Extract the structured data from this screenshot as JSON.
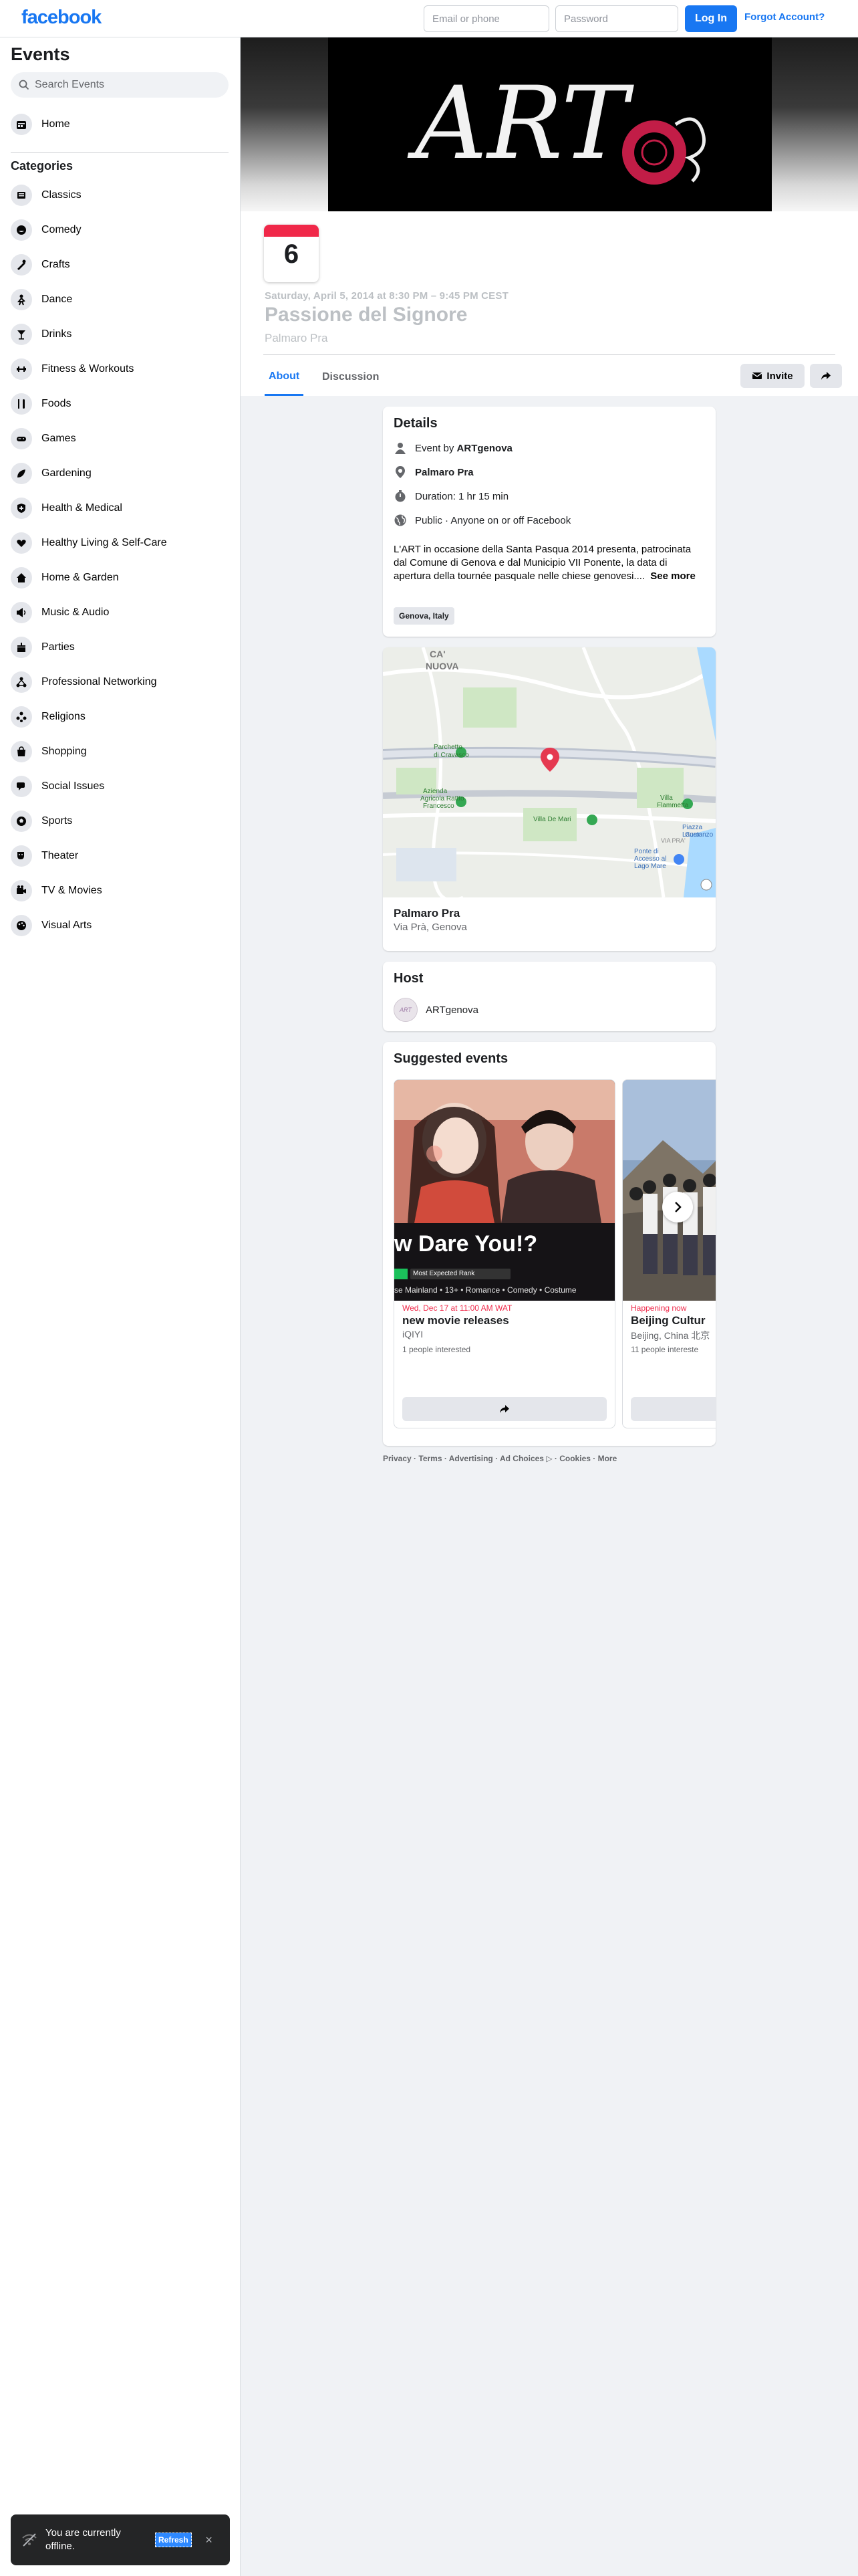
{
  "topbar": {
    "logo": "facebook",
    "email_placeholder": "Email or phone",
    "password_placeholder": "Password",
    "login_label": "Log In",
    "forgot_label": "Forgot Account?"
  },
  "sidebar": {
    "title": "Events",
    "search_placeholder": "Search Events",
    "home_label": "Home",
    "categories_title": "Categories",
    "categories": [
      {
        "label": "Classics",
        "icon": "classics-icon"
      },
      {
        "label": "Comedy",
        "icon": "comedy-icon"
      },
      {
        "label": "Crafts",
        "icon": "crafts-icon"
      },
      {
        "label": "Dance",
        "icon": "dance-icon"
      },
      {
        "label": "Drinks",
        "icon": "drinks-icon"
      },
      {
        "label": "Fitness & Workouts",
        "icon": "fitness-icon"
      },
      {
        "label": "Foods",
        "icon": "foods-icon"
      },
      {
        "label": "Games",
        "icon": "games-icon"
      },
      {
        "label": "Gardening",
        "icon": "gardening-icon"
      },
      {
        "label": "Health & Medical",
        "icon": "health-icon"
      },
      {
        "label": "Healthy Living & Self-Care",
        "icon": "healthy-living-icon"
      },
      {
        "label": "Home & Garden",
        "icon": "home-garden-icon"
      },
      {
        "label": "Music & Audio",
        "icon": "music-icon"
      },
      {
        "label": "Parties",
        "icon": "parties-icon"
      },
      {
        "label": "Professional Networking",
        "icon": "networking-icon"
      },
      {
        "label": "Religions",
        "icon": "religions-icon"
      },
      {
        "label": "Shopping",
        "icon": "shopping-icon"
      },
      {
        "label": "Social Issues",
        "icon": "social-issues-icon"
      },
      {
        "label": "Sports",
        "icon": "sports-icon"
      },
      {
        "label": "Theater",
        "icon": "theater-icon"
      },
      {
        "label": "TV & Movies",
        "icon": "tv-movies-icon"
      },
      {
        "label": "Visual Arts",
        "icon": "visual-arts-icon"
      }
    ]
  },
  "event": {
    "cover_text": "ART",
    "day": "6",
    "date_line": "Saturday, April 5, 2014 at 8:30 PM – 9:45 PM CEST",
    "title": "Passione del Signore",
    "location": "Palmaro Pra",
    "tabs": [
      "About",
      "Discussion"
    ],
    "invite_label": "Invite"
  },
  "details": {
    "title": "Details",
    "event_by_prefix": "Event by ",
    "event_by": "ARTgenova",
    "place": "Palmaro Pra",
    "duration": "Duration: 1 hr 15 min",
    "privacy": "Public · Anyone on or off Facebook",
    "description": "L'ART in occasione della Santa Pasqua 2014 presenta, patrocinata dal Comune di Genova e dal Municipio VII Ponente, la data di apertura della tournée pasquale nelle chiese genovesi....",
    "see_more": "See more",
    "tag": "Genova, Italy"
  },
  "map": {
    "labels": [
      "CA'",
      "NUOVA",
      "Parchetto",
      "di Cravasco",
      "Azienda",
      "Agricola Rattto",
      "Francesco",
      "Villa De Mari",
      "Villa",
      "Flammetta",
      "Piazza Lauro",
      "Costanzo",
      "Ponte di",
      "Accesso al",
      "Lago Mare",
      "VIA PRA'"
    ],
    "place_name": "Palmaro Pra",
    "place_address": "Via Prà, Genova"
  },
  "host": {
    "title": "Host",
    "name": "ARTgenova"
  },
  "suggested": {
    "title": "Suggested events",
    "items": [
      {
        "poster_title": "w Dare You!?",
        "poster_badge": "Most Expected Rank",
        "poster_meta": "se Mainland • 13+ • Romance • Comedy • Costume",
        "date": "Wed, Dec 17 at 11:00 AM WAT",
        "title": "new movie releases",
        "host": "iQIYI",
        "interest": "1 people interested"
      },
      {
        "date": "Happening now",
        "title": "Beijing Cultur",
        "host": "Beijing, China 北京",
        "interest": "11 people intereste"
      }
    ]
  },
  "footer": {
    "links": [
      "Privacy",
      "Terms",
      "Advertising",
      "Ad Choices",
      "Cookies",
      "More"
    ]
  },
  "toast": {
    "text": "You are currently offline.",
    "action": "Refresh"
  },
  "colors": {
    "brand": "#1877f2",
    "date_accent": "#f02849",
    "map_pin": "#e53950"
  }
}
